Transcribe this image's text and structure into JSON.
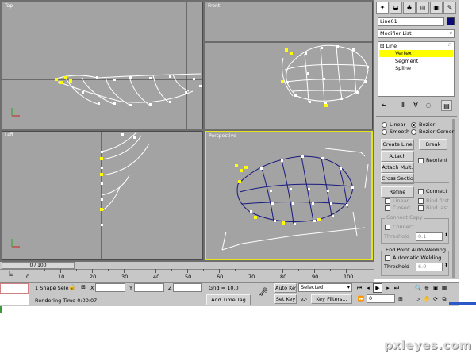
{
  "viewports": {
    "top": {
      "label": "Top"
    },
    "front": {
      "label": "Front"
    },
    "left": {
      "label": "Left"
    },
    "perspective": {
      "label": "Perspective"
    }
  },
  "command_panel": {
    "object_name": "Line01",
    "modifier_list": "Modifier List",
    "stack": [
      "Line",
      "Vertex",
      "Segment",
      "Spline"
    ],
    "radio_linear": "Linear",
    "radio_bezier": "Bezier",
    "radio_smooth": "Smooth",
    "radio_bezier_corner": "Bezier Corner",
    "create_line": "Create Line",
    "break": "Break",
    "attach": "Attach",
    "reorient": "Reorient",
    "attach_mult": "Attach Mult.",
    "cross_section": "Cross Section",
    "refine": "Refine",
    "connect": "Connect",
    "linear": "Linear",
    "bind_first": "Bind first",
    "closed": "Closed",
    "bind_last": "Bind last",
    "connect_copy_title": "Connect Copy",
    "connect_copy_connect": "Connect",
    "threshold": "Threshold",
    "threshold_value_1": "0.1",
    "end_point_title": "End Point Auto-Welding",
    "automatic_welding": "Automatic Welding",
    "threshold_value_2": "6.0"
  },
  "timeline": {
    "frame": "0 / 100",
    "ticks": [
      "0",
      "10",
      "20",
      "30",
      "40",
      "50",
      "60",
      "70",
      "80",
      "90",
      "100"
    ]
  },
  "status": {
    "selection": "1 Shape Sele",
    "x_label": "X",
    "y_label": "Y",
    "z_label": "Z",
    "grid": "Grid = 10.0",
    "rendering_time": "Rendering Time  0:00:07",
    "add_time_tag": "Add Time Tag",
    "auto_key": "Auto Key",
    "selected": "Selected",
    "set_key": "Set Key",
    "key_filters": "Key Filters...",
    "frame_field": "0"
  },
  "watermark": "pxleyes.com",
  "colors": {
    "viewport_bg": "#a3a3a3",
    "active_border": "#e6e41a",
    "selected_vertex": "#ffff00",
    "perspective_line": "#1a1a80",
    "panel_bg": "#c7c7c7"
  }
}
